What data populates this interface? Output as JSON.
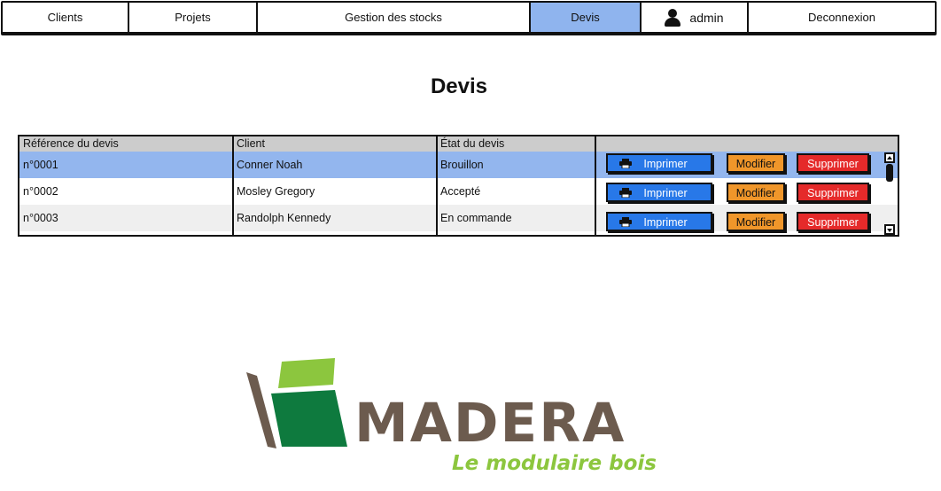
{
  "nav": {
    "items": [
      {
        "label": "Clients",
        "active": false
      },
      {
        "label": "Projets",
        "active": false
      },
      {
        "label": "Gestion des stocks",
        "active": false
      },
      {
        "label": "Devis",
        "active": true
      },
      {
        "label": "admin",
        "icon": "user-icon",
        "active": false
      },
      {
        "label": "Deconnexion",
        "active": false
      }
    ]
  },
  "page": {
    "title": "Devis"
  },
  "table": {
    "columns": [
      "Référence du devis",
      "Client",
      "État du devis"
    ],
    "rows": [
      {
        "reference": "n°0001",
        "client": "Conner Noah",
        "status": "Brouillon",
        "selected": true
      },
      {
        "reference": "n°0002",
        "client": "Mosley Gregory",
        "status": "Accepté",
        "selected": false
      },
      {
        "reference": "n°0003",
        "client": "Randolph Kennedy",
        "status": "En commande",
        "selected": false
      }
    ],
    "actions": {
      "print_label": "Imprimer",
      "print_icon": "printer-icon",
      "edit_label": "Modifier",
      "delete_label": "Supprimer"
    },
    "colors": {
      "selected_row": "#93b6ee",
      "print": "#2878e8",
      "edit": "#f0962a",
      "delete": "#e52a2a"
    }
  },
  "logo": {
    "wordmark": "MADERA",
    "tagline": "Le modulaire bois",
    "colors": {
      "brown": "#6c5b4e",
      "dark_green": "#0e7a3e",
      "light_green": "#8cc63e"
    }
  }
}
